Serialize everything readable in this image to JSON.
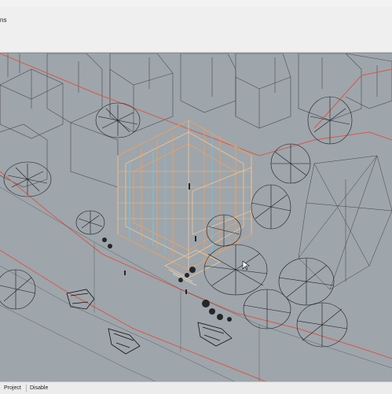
{
  "command": {
    "history_tail": "ns"
  },
  "viewport": {
    "background": "#9ea5ab",
    "wire_color": "#222222",
    "boundary_color": "#d65a4a",
    "highlight_colors": [
      "#f5a05a",
      "#f7c590",
      "#6ad0e0"
    ]
  },
  "status_bar": {
    "panes": [
      {
        "label": "Project"
      },
      {
        "label": "Disable"
      }
    ]
  },
  "icons": {
    "cursor": "arrow-cursor-icon"
  }
}
